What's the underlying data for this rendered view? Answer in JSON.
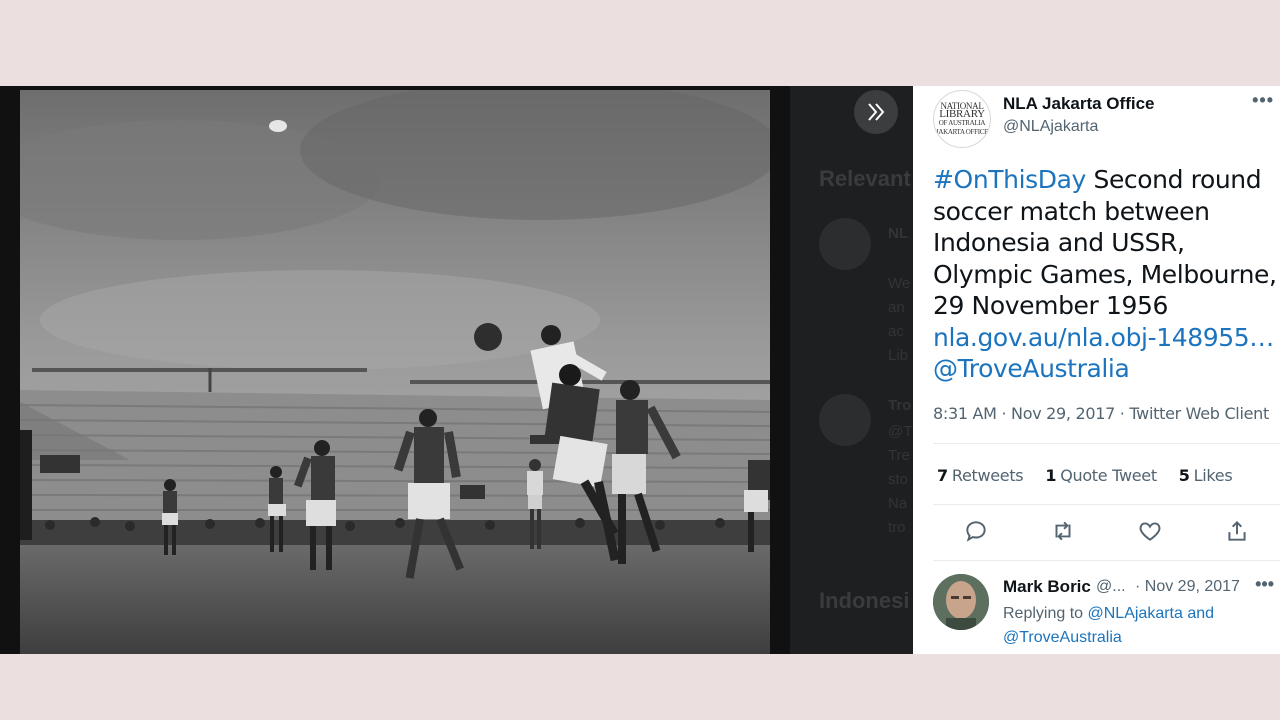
{
  "viewer": {
    "expand_icon": "double-chevron-right-icon",
    "background_text": {
      "heading1": "Relevant",
      "heading2": "Indonesi",
      "item1_name": "NL",
      "item1_lines": [
        "We",
        "an",
        "ac",
        "Lib"
      ],
      "item2_name": "Tro",
      "item2_lines": [
        "@T",
        "Tre",
        "sto",
        "Na",
        "tro"
      ]
    }
  },
  "tweet": {
    "author_name": "NLA Jakarta Office",
    "author_handle": "@NLAjakarta",
    "avatar_lines": [
      "NATIONAL",
      "LIBRARY",
      "OF AUSTRALIA",
      "JAKARTA OFFICE"
    ],
    "more_label": "•••",
    "hashtag": "#OnThisDay",
    "body": " Second round soccer match between Indonesia and USSR, Olympic Games, Melbourne, 29 November 1956",
    "link": "nla.gov.au/nla.obj-148955…",
    "mention": "@TroveAustralia",
    "time": "8:31 AM",
    "sep": " · ",
    "date": "Nov 29, 2017",
    "source": "Twitter Web Client",
    "retweets_count": "7",
    "retweets_label": "Retweets",
    "quotes_count": "1",
    "quotes_label": "Quote Tweet",
    "likes_count": "5",
    "likes_label": "Likes",
    "action_icons": [
      "reply-icon",
      "retweet-icon",
      "like-icon",
      "share-icon"
    ]
  },
  "reply": {
    "name": "Mark Boric",
    "handle": "@...",
    "date": "· Nov 29, 2017",
    "more_label": "•••",
    "replying_prefix": "Replying to ",
    "mention1": "@NLAjakarta",
    "and": " and ",
    "mention2": "@TroveAustralia"
  },
  "colors": {
    "link": "#1b74bd",
    "text": "#0f1419",
    "muted": "#536471",
    "page_bg": "#ecdfe0"
  }
}
